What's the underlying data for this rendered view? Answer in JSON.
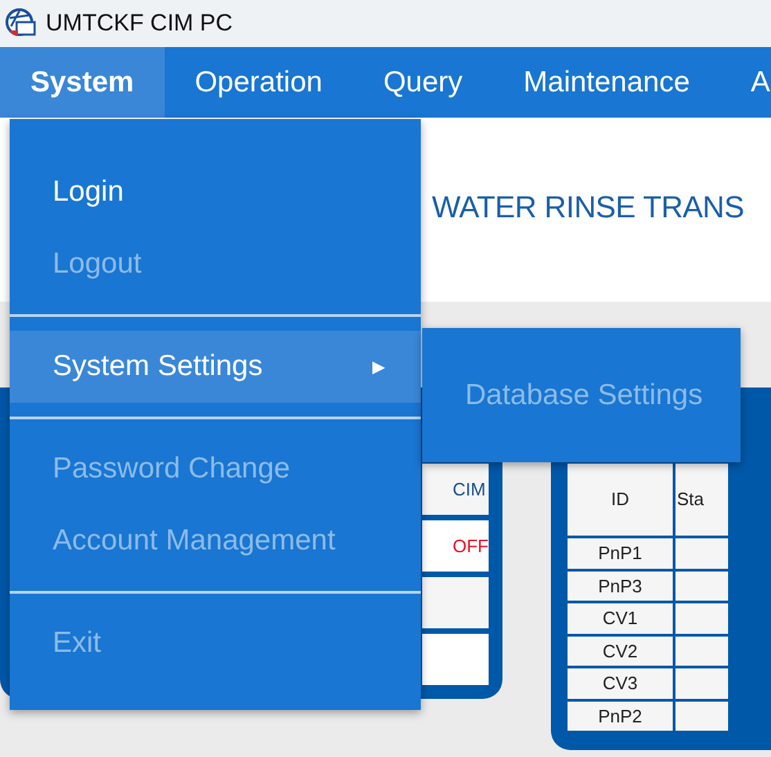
{
  "window": {
    "title": "UMTCKF CIM PC"
  },
  "menubar": [
    {
      "label": "System",
      "selected": true
    },
    {
      "label": "Operation",
      "selected": false
    },
    {
      "label": "Query",
      "selected": false
    },
    {
      "label": "Maintenance",
      "selected": false
    },
    {
      "label": "A",
      "selected": false
    }
  ],
  "page_title": "WATER RINSE TRANS",
  "left_panel": {
    "cells": [
      {
        "text": "CIM",
        "kind": "label"
      },
      {
        "text": "OFF",
        "kind": "status"
      }
    ]
  },
  "right_panel": {
    "columns": [
      "ID",
      "Sta"
    ],
    "rows": [
      "PnP1",
      "PnP3",
      "CV1",
      "CV2",
      "CV3",
      "PnP2"
    ]
  },
  "system_menu": {
    "items": [
      {
        "kind": "item",
        "label": "Login",
        "disabled": false,
        "selected": false
      },
      {
        "kind": "item",
        "label": "Logout",
        "disabled": true,
        "selected": false
      },
      {
        "kind": "separator"
      },
      {
        "kind": "submenu",
        "label": "System Settings",
        "arrow": "▶",
        "disabled": false,
        "selected": true
      },
      {
        "kind": "separator"
      },
      {
        "kind": "item",
        "label": "Password Change",
        "disabled": true,
        "selected": false
      },
      {
        "kind": "item",
        "label": "Account Management",
        "disabled": true,
        "selected": false
      },
      {
        "kind": "separator"
      },
      {
        "kind": "item",
        "label": "Exit",
        "disabled": true,
        "selected": false
      }
    ]
  },
  "submenu": {
    "items": [
      {
        "label": "Database Settings",
        "disabled": true
      }
    ]
  }
}
